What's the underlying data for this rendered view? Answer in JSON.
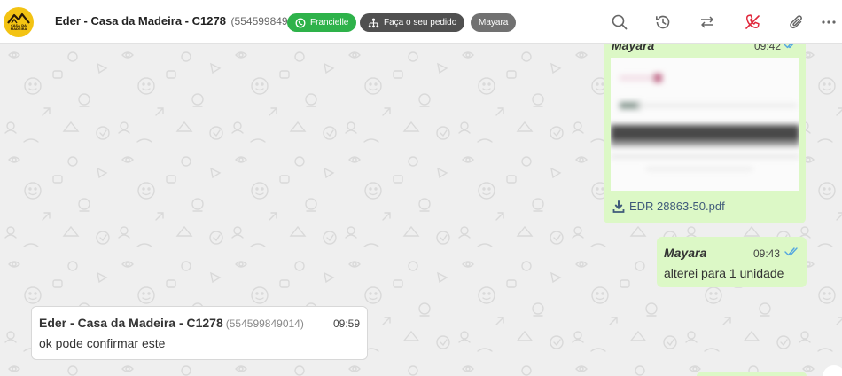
{
  "header": {
    "logo_text": "CASA DA MADEIRA",
    "contact_name": "Eder - Casa da Madeira - C1278",
    "contact_phone": "(554599849014)",
    "tags": [
      {
        "label": "Francielle",
        "icon": "whatsapp-icon",
        "color": "#2eb24a"
      },
      {
        "label": "Faça o seu pedido",
        "icon": "sitemap-icon",
        "color": "#505050"
      },
      {
        "label": "Mayara",
        "icon": "",
        "color": "#717171"
      }
    ],
    "actions": [
      "search-icon",
      "history-icon",
      "transfer-icon",
      "end-call-icon",
      "attach-icon",
      "more-icon"
    ]
  },
  "messages": [
    {
      "direction": "out",
      "sender": "Mayara",
      "time": "09:42",
      "type": "document",
      "filename": "EDR 28863-50.pdf",
      "read": true
    },
    {
      "direction": "out",
      "sender": "Mayara",
      "time": "09:43",
      "type": "text",
      "text": "alterei para 1 unidade",
      "read": true
    },
    {
      "direction": "in",
      "sender": "Eder - Casa da Madeira - C1278",
      "phone": "(554599849014)",
      "time": "09:59",
      "type": "text",
      "text": "ok pode confirmar este"
    }
  ],
  "colors": {
    "outgoing_bubble": "#dcf8c6",
    "incoming_bubble": "#ffffff",
    "chat_background": "#efefef",
    "read_ticks": "#53a6e0",
    "end_call": "#e0263a"
  }
}
